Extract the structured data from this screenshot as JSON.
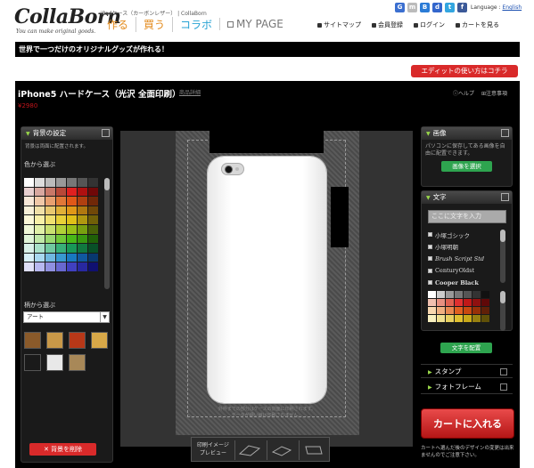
{
  "header": {
    "logo": "CollaBorn",
    "tagline": "You can make original goods.",
    "breadcrumb_links": "iPadケース（カーボンレザー） | CollaBorn",
    "main_nav": [
      {
        "label": "作る",
        "color": "#e38a1b"
      },
      {
        "label": "買う",
        "color": "#e38a1b"
      },
      {
        "label": "コラボ",
        "color": "#29a3d4"
      },
      {
        "label": "MY PAGE",
        "color": "#777777"
      }
    ],
    "social": [
      {
        "icon": "google-icon",
        "char": "G",
        "color": "#3b6fd0"
      },
      {
        "icon": "mixi-icon",
        "char": "m",
        "color": "#bbbbbb"
      },
      {
        "icon": "hatena-icon",
        "char": "B",
        "color": "#2b7bd6"
      },
      {
        "icon": "delicious-icon",
        "char": "d",
        "color": "#3366cc"
      },
      {
        "icon": "twitter-icon",
        "char": "t",
        "color": "#33a6e0"
      },
      {
        "icon": "facebook-icon",
        "char": "f",
        "color": "#3b5998"
      }
    ],
    "language_label": "Language : ",
    "language_link": "English",
    "sub_nav": [
      "サイトマップ",
      "会員登録",
      "ログイン",
      "カートを見る"
    ]
  },
  "banner": "世界で一つだけのオリジナルグッズが作れる！",
  "edit_help_button": "エディットの使い方はコチラ",
  "product": {
    "title": "iPhone5 ハードケース（光沢 全面印刷）",
    "detail_link": "商品詳細",
    "price": "¥2980",
    "help": "ヘルプ",
    "notes": "注意事項"
  },
  "left_panel": {
    "title": "背景の設定",
    "note": "背景は両面に配置されます。",
    "color_label": "色から選ぶ",
    "pattern_label": "柄から選ぶ",
    "pattern_selected": "アート",
    "delete_button": "背景を削除",
    "colors": [
      "#ffffff",
      "#dddddd",
      "#bbbbbb",
      "#999999",
      "#777777",
      "#555555",
      "#333333",
      "#e8d0d0",
      "#d8a8a0",
      "#c87868",
      "#b84838",
      "#e02020",
      "#b01010",
      "#700808",
      "#f8e8d8",
      "#f0c8a8",
      "#e8a070",
      "#e07838",
      "#e05818",
      "#b04010",
      "#702808",
      "#f8f0d8",
      "#f0e0a8",
      "#e8c870",
      "#e0b038",
      "#e09818",
      "#b07810",
      "#704808",
      "#fcf8d8",
      "#f8f0a8",
      "#f0e070",
      "#e8d038",
      "#e0c018",
      "#b09810",
      "#706008",
      "#f0f8d8",
      "#e0f0a8",
      "#c8e070",
      "#b0d038",
      "#98c018",
      "#78a010",
      "#486008",
      "#e0f4d8",
      "#c0e8a8",
      "#98d870",
      "#70c838",
      "#48b818",
      "#389810",
      "#206008",
      "#d8f0e8",
      "#a8e0c8",
      "#70c8a0",
      "#38b078",
      "#189858",
      "#107840",
      "#085028",
      "#d8f0f8",
      "#a8d8f0",
      "#70b8e0",
      "#3898d0",
      "#1878c0",
      "#1058a0",
      "#083870",
      "#e0e0f8",
      "#b8b8f0",
      "#9090e0",
      "#6868d0",
      "#4040c0",
      "#2828a0",
      "#101070"
    ],
    "pattern_thumbs": [
      "#8a5a2a",
      "#c89848",
      "#b83818",
      "#d8a848",
      "#1a1a1a",
      "#e8e8e8",
      "#a88858"
    ]
  },
  "canvas": {
    "note": "外枠までの部分はケースの側面に印刷されます。データが細い線は印刷されません。",
    "preview_label": "印刷イメージプレビュー"
  },
  "right_panel": {
    "image_title": "画像",
    "image_note": "パソコンに保存してある画像を自由に配置できます。",
    "image_button": "画像を選択",
    "text_title": "文字",
    "text_placeholder": "ここに文字を入力",
    "fonts": [
      "小塚ゴシック",
      "小塚明朝",
      "Brush Script Std",
      "CenturyOldst",
      "Cooper Black"
    ],
    "text_colors": [
      "#ffffff",
      "#cccccc",
      "#999999",
      "#777777",
      "#555555",
      "#333333",
      "#111111",
      "#f0c0b0",
      "#e89080",
      "#e06050",
      "#e03030",
      "#c01818",
      "#901010",
      "#600808",
      "#f8d8b0",
      "#f0b080",
      "#e88850",
      "#e06020",
      "#c84810",
      "#983008",
      "#602008",
      "#f8f0c0",
      "#f0e090",
      "#e8d060",
      "#e0c030",
      "#c8a818",
      "#988010",
      "#605008"
    ],
    "text_button": "文字を配置",
    "stamp": "スタンプ",
    "frame": "フォトフレーム",
    "cart_button": "カートに入れる",
    "cart_note": "カートへ選んだ後のデザインの変更は出来ませんのでご注意下さい。"
  }
}
